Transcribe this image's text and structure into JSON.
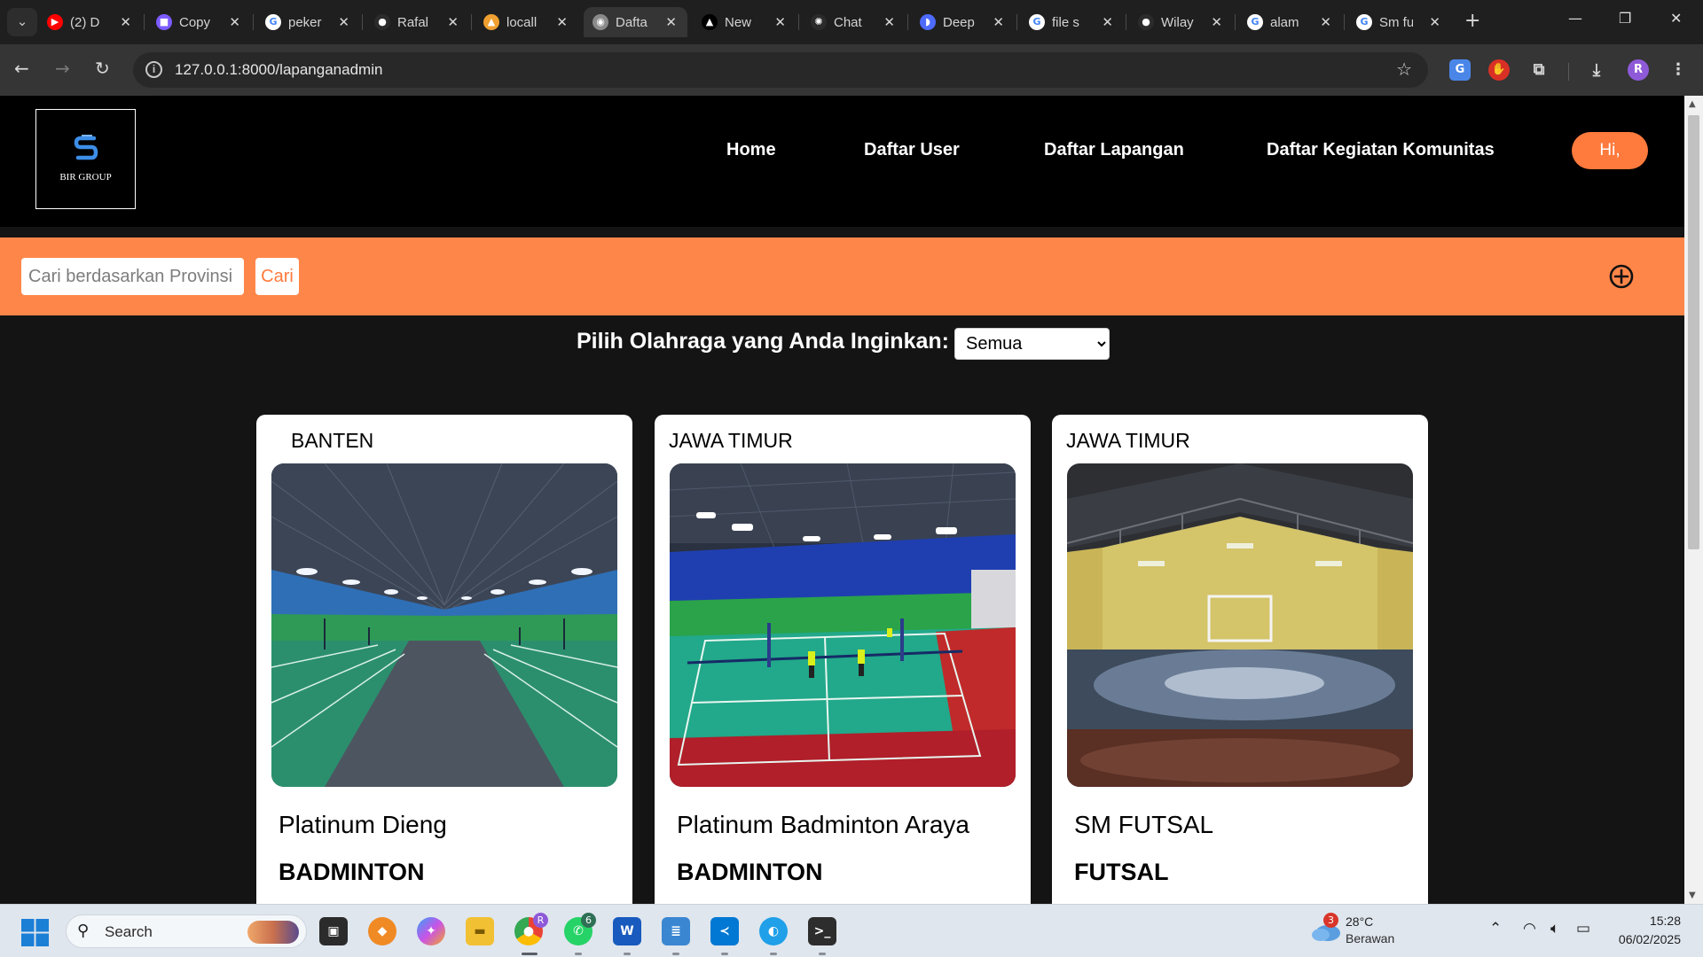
{
  "browser": {
    "tabs": [
      {
        "title": "(2) D",
        "icon": "youtube-icon",
        "icon_color": "#ff0000",
        "icon_glyph": "▶",
        "active": false
      },
      {
        "title": "Copy",
        "icon": "copy-app-icon",
        "icon_color": "#7c5cff",
        "icon_glyph": "■",
        "active": false
      },
      {
        "title": "peker",
        "icon": "google-icon",
        "icon_color": "#ffffff",
        "icon_glyph": "G",
        "active": false
      },
      {
        "title": "Rafal",
        "icon": "github-icon",
        "icon_color": "#2b2b2b",
        "icon_glyph": "●",
        "active": false
      },
      {
        "title": "locall",
        "icon": "phpmyadmin-icon",
        "icon_color": "#f0a030",
        "icon_glyph": "▲",
        "active": false
      },
      {
        "title": "Dafta",
        "icon": "globe-icon",
        "icon_color": "#8a8a8a",
        "icon_glyph": "◉",
        "active": true
      },
      {
        "title": "New",
        "icon": "vercel-icon",
        "icon_color": "#000000",
        "icon_glyph": "▲",
        "active": false
      },
      {
        "title": "Chat",
        "icon": "chatgpt-icon",
        "icon_color": "#2b2b2b",
        "icon_glyph": "✺",
        "active": false
      },
      {
        "title": "Deep",
        "icon": "deepseek-icon",
        "icon_color": "#4d6bfe",
        "icon_glyph": "◗",
        "active": false
      },
      {
        "title": "file s",
        "icon": "google-icon",
        "icon_color": "#ffffff",
        "icon_glyph": "G",
        "active": false
      },
      {
        "title": "Wilay",
        "icon": "github-icon",
        "icon_color": "#2b2b2b",
        "icon_glyph": "●",
        "active": false
      },
      {
        "title": "alam",
        "icon": "google-icon",
        "icon_color": "#ffffff",
        "icon_glyph": "G",
        "active": false
      },
      {
        "title": "Sm fu",
        "icon": "google-icon",
        "icon_color": "#ffffff",
        "icon_glyph": "G",
        "active": false
      }
    ],
    "url": "127.0.0.1:8000/lapanganadmin",
    "profile_initial": "R"
  },
  "site": {
    "logo_text": "BIR GROUP",
    "nav": [
      "Home",
      "Daftar User",
      "Daftar Lapangan",
      "Daftar Kegiatan Komunitas"
    ],
    "greeting": "Hi,",
    "colors": {
      "accent": "#ff7a3d",
      "band": "#ff8649",
      "header": "#000000"
    }
  },
  "search": {
    "placeholder": "Cari berdasarkan Provinsi",
    "button": "Cari"
  },
  "filter": {
    "label": "Pilih Olahraga yang Anda Inginkan:",
    "selected": "Semua"
  },
  "venues": [
    {
      "province": "BANTEN",
      "name": "Platinum Dieng",
      "sport": "BADMINTON"
    },
    {
      "province": "JAWA TIMUR",
      "name": "Platinum Badminton Araya",
      "sport": "BADMINTON"
    },
    {
      "province": "JAWA TIMUR",
      "name": "SM FUTSAL",
      "sport": "FUTSAL"
    }
  ],
  "taskbar": {
    "search_label": "Search",
    "weather_temp": "28°C",
    "weather_desc": "Berawan",
    "weather_badge": "3",
    "whatsapp_badge": "6",
    "chrome_badge": "R",
    "time": "15:28",
    "date": "06/02/2025"
  }
}
